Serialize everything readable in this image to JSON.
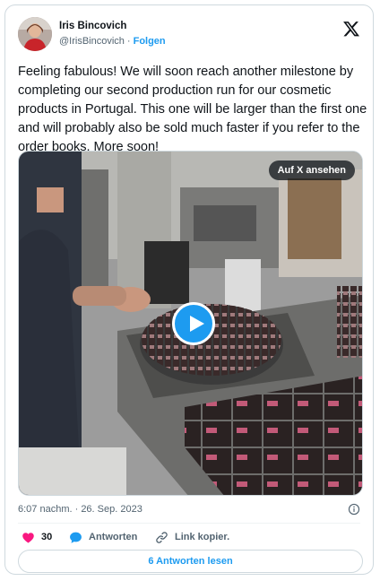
{
  "author": {
    "name": "Iris Bincovich",
    "handle": "@IrisBincovich",
    "separator": "·",
    "follow_label": "Folgen"
  },
  "tweet": {
    "text": "Feeling fabulous! We will soon reach another milestone by completing our second production run for our cosmetic products in Portugal. This one will be larger than the first one and will probably also be sold much faster if you refer to the order books. More soon!"
  },
  "media": {
    "watch_label": "Auf X ansehen"
  },
  "meta": {
    "timestamp": "6:07 nachm. · 26. Sep. 2023"
  },
  "actions": {
    "like_count": "30",
    "reply_label": "Antworten",
    "copy_label": "Link kopier."
  },
  "replies_button_label": "6 Antworten lesen",
  "colors": {
    "accent": "#1d9bf0",
    "like": "#f91880",
    "text": "#0f1419",
    "muted": "#536471",
    "border": "#cfd9de"
  },
  "icons": [
    "x-logo-icon",
    "info-icon",
    "heart-icon",
    "reply-bubble-icon",
    "link-icon",
    "play-icon"
  ]
}
